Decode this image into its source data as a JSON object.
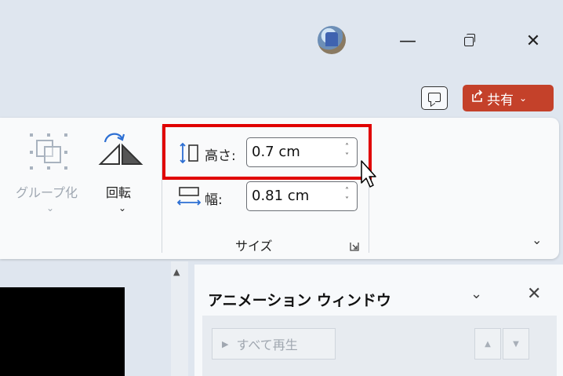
{
  "window": {
    "minimize_glyph": "—",
    "close_glyph": "✕"
  },
  "header": {
    "share_label": "共有",
    "share_chevron": "⌄"
  },
  "ribbon": {
    "group_label": "グループ化",
    "group_chevron": "⌄",
    "rotate_label": "回転",
    "rotate_chevron": "⌄",
    "height_label": "高さ:",
    "height_value": "0.7 cm",
    "width_label": "幅:",
    "width_value": "0.81 cm",
    "size_group_label": "サイズ",
    "collapse_chevron": "⌄",
    "spin_up": "˄",
    "spin_down": "˅"
  },
  "animation_pane": {
    "title": "アニメーション ウィンドウ",
    "play_all_label": "すべて再生",
    "chevron": "⌄",
    "close_glyph": "✕",
    "move_up_glyph": "▲",
    "move_down_glyph": "▼"
  },
  "colors": {
    "accent_share": "#c4412a",
    "highlight": "#e00000",
    "icon_blue": "#2d6fd3"
  }
}
